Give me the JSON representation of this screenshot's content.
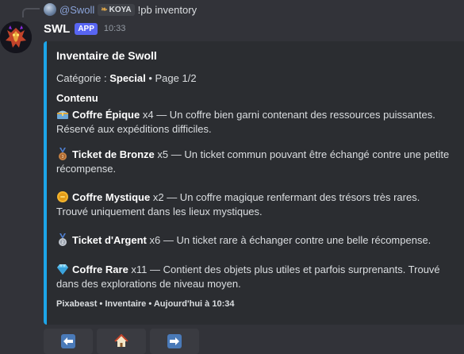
{
  "reply": {
    "username": "@Swoll",
    "tag_label": "KOYA",
    "message": "!pb inventory"
  },
  "message": {
    "author": "SWL",
    "badge": "APP",
    "time": "10:33"
  },
  "embed": {
    "accent_color": "#1ca5e8",
    "title": "Inventaire de Swoll",
    "category_prefix": "Catégorie : ",
    "category_value": "Special",
    "page_text": " • Page 1/2",
    "section_label": "Contenu",
    "items": [
      {
        "icon": "treasure-chest-icon",
        "name": "Coffre Épique",
        "qty": " x4",
        "desc": " — Un coffre bien garni contenant des ressources puissantes. Réservé aux expéditions difficiles."
      },
      {
        "icon": "bronze-medal-icon",
        "name": "Ticket de Bronze",
        "qty": " x5",
        "desc": " — Un ticket commun pouvant être échangé contre une petite récompense."
      },
      {
        "icon": "gold-coin-icon",
        "name": "Coffre Mystique",
        "qty": " x2",
        "desc": " — Un coffre magique renfermant des trésors très rares. Trouvé uniquement dans les lieux mystiques."
      },
      {
        "icon": "silver-medal-icon",
        "name": "Ticket d'Argent",
        "qty": " x6",
        "desc": " — Un ticket rare à échanger contre une belle récompense."
      },
      {
        "icon": "diamond-icon",
        "name": "Coffre Rare",
        "qty": " x11",
        "desc": " — Contient des objets plus utiles et parfois surprenants. Trouvé dans des explorations de niveau moyen."
      }
    ],
    "footer": "Pixabeast • Inventaire • Aujourd'hui à 10:34"
  },
  "buttons": [
    {
      "icon": "left-arrow-icon",
      "glyph": "🡄"
    },
    {
      "icon": "house-icon",
      "glyph": "⌂"
    },
    {
      "icon": "right-arrow-icon",
      "glyph": "🡆"
    }
  ]
}
